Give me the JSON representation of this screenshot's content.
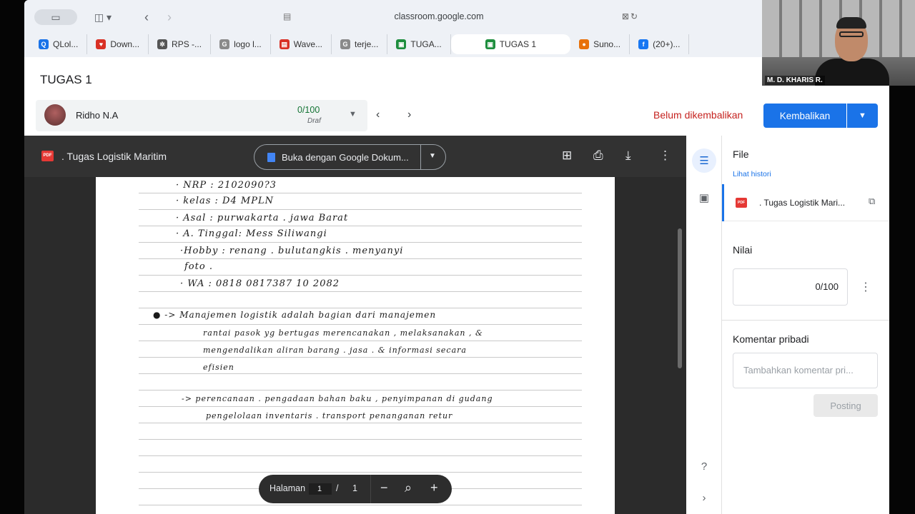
{
  "browser": {
    "url": "classroom.google.com",
    "tabs": [
      {
        "label": "QLol...",
        "color": "#1a73e8",
        "glyph": "Q"
      },
      {
        "label": "Down...",
        "color": "#d93025",
        "glyph": "♥"
      },
      {
        "label": "RPS -...",
        "color": "#555555",
        "glyph": "✲"
      },
      {
        "label": "logo l...",
        "color": "#8a8a8a",
        "glyph": "G"
      },
      {
        "label": "Wave...",
        "color": "#d93025",
        "glyph": "▤"
      },
      {
        "label": "terje...",
        "color": "#8a8a8a",
        "glyph": "G"
      },
      {
        "label": "TUGA...",
        "color": "#1e8e3e",
        "glyph": "▣"
      },
      {
        "label": "TUGAS 1",
        "color": "#1e8e3e",
        "glyph": "▣"
      },
      {
        "label": "Suno...",
        "color": "#e8710a",
        "glyph": "●"
      },
      {
        "label": "(20+)...",
        "color": "#1877f2",
        "glyph": "f"
      }
    ],
    "active_tab_index": 7
  },
  "header": {
    "title": "TUGAS 1",
    "student_name": "Ridho N.A",
    "grade": "0/100",
    "status": "Draf",
    "not_returned": "Belum dikembalikan",
    "return_button": "Kembalikan"
  },
  "viewer": {
    "file_title": ". Tugas Logistik Maritim",
    "open_with": "Buka dengan Google Dokum...",
    "page_label": "Halaman",
    "page_current": "1",
    "page_separator": "/",
    "page_total": "1",
    "handwriting": [
      "· NRP  : 2102090?3",
      "· kelas  : D4  MPLN",
      "· Asal  : purwakarta . jawa  Barat",
      "· A. Tinggal:  Mess   Siliwangi",
      "·Hobby  : renang .  bulutangkis .  menyanyi",
      " foto .",
      "· WA     : 0818  0817387 10 2082",
      "●  ->    Manajemen    logistik    adalah    bagian    dari    manajemen",
      "rantai    pasok    yg    bertugas    merencanakan  ,  melaksanakan  ,  &",
      "mengendalikan    aliran    barang  .  jasa  . &   informasi    secara",
      "efisien",
      "->   perencanaan  . pengadaan   bahan  baku  ,  penyimpanan   di  gudang",
      "pengelolaan   inventaris  .  transport   penanganan   retur"
    ]
  },
  "side_panel": {
    "file_heading": "File",
    "history_link": "Lihat histori",
    "file_name": ". Tugas Logistik Mari...",
    "grade_heading": "Nilai",
    "grade_value": "0/100",
    "comment_heading": "Komentar pribadi",
    "comment_placeholder": "Tambahkan komentar pri...",
    "post_button": "Posting"
  },
  "webcam": {
    "participant_name": "M. D. KHARIS R."
  },
  "colors": {
    "accent": "#1a73e8",
    "warning": "#c5221f",
    "grade_green": "#137333"
  }
}
